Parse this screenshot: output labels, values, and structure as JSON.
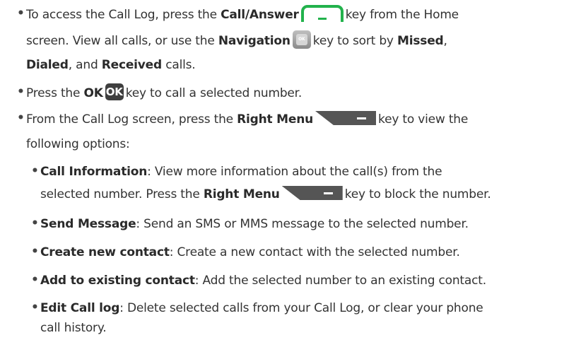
{
  "bullet": "•",
  "items": {
    "call_log": {
      "l1a": "To access the Call Log, press the ",
      "l1b": "Call/Answer",
      "l1c": "key from the Home",
      "l2a": "screen. View all calls, or use the ",
      "l2b": "Navigation",
      "l2c": "key to sort by ",
      "l2d": "Missed",
      "l2e": ",",
      "l3a": "Dialed",
      "l3b": ", and ",
      "l3c": "Received",
      "l3d": " calls."
    },
    "ok": {
      "a": "Press the ",
      "b": "OK",
      "c": "key to call a selected number."
    },
    "right_menu": {
      "a": "From the Call Log screen, press the ",
      "b": "Right Menu",
      "c": "key to view the",
      "d": "following options:"
    }
  },
  "keys": {
    "nav_label": "OK",
    "ok_label": "OK"
  },
  "options": {
    "call_info": {
      "term": "Call Information",
      "a": ": View more information about the call(s) from the",
      "b": "selected number. Press the ",
      "c": "Right Menu",
      "d": "key to block the number."
    },
    "send_message": {
      "term": "Send Message",
      "desc": ": Send an SMS or MMS message to the selected number."
    },
    "create_contact": {
      "term": "Create new contact",
      "desc": ": Create a new contact with the selected number."
    },
    "add_existing": {
      "term": "Add to existing contact",
      "desc": ": Add the selected number to an existing contact."
    },
    "edit_log": {
      "term": "Edit Call log",
      "a": ": Delete selected calls from your Call Log, or clear your phone",
      "b": "call history."
    }
  },
  "colors": {
    "text": "#333333",
    "call_key": "#22b24c",
    "key_dark": "#555555"
  }
}
